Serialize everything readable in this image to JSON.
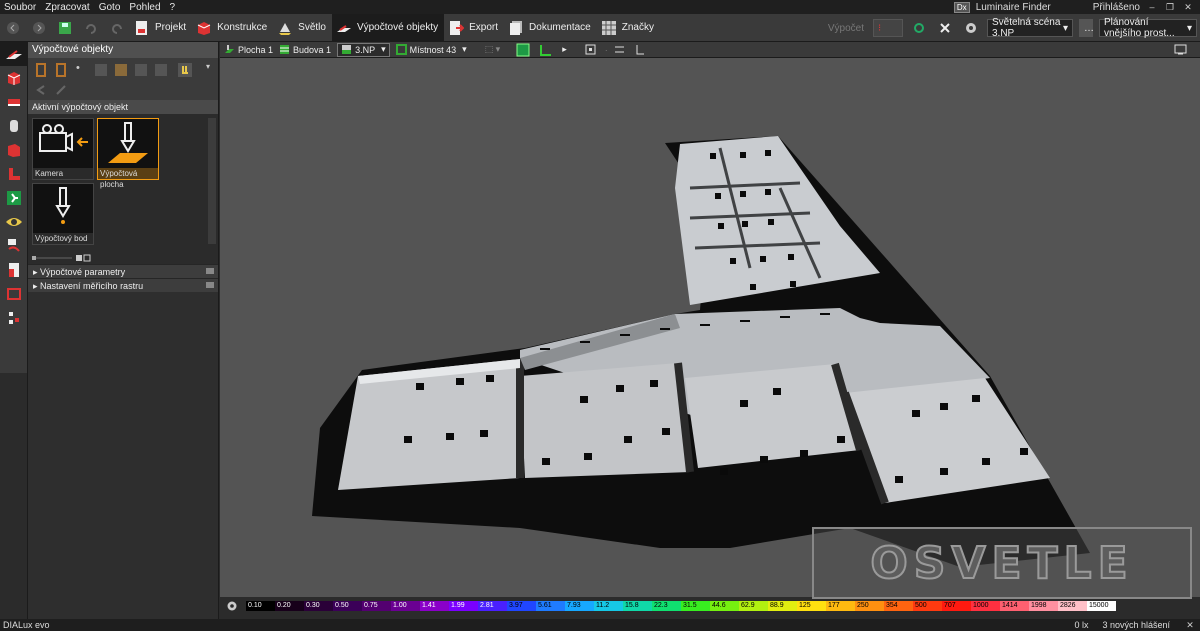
{
  "menu": [
    "Soubor",
    "Zpracovat",
    "Goto",
    "Pohled",
    "?"
  ],
  "topright": {
    "badge": "Dx",
    "finder": "Luminaire Finder",
    "login": "Přihlášeno"
  },
  "toolbar": {
    "modes": [
      "Projekt",
      "Konstrukce",
      "Světlo",
      "Výpočtové objekty",
      "Export",
      "Dokumentace",
      "Značky"
    ],
    "active_mode": "Výpočtové objekty",
    "calc_label": "Výpočet",
    "scene": "Světelná scéna 3.NP",
    "planning": "Plánování vnějšího prost..."
  },
  "panel": {
    "title": "Výpočtové objekty",
    "section": "Aktivní výpočtový objekt",
    "cards": [
      "Kamera",
      "Výpočtová plocha",
      "Výpočtový bod"
    ],
    "collapsibles": [
      "Výpočtové parametry",
      "Nastavení měřicího rastru"
    ]
  },
  "breadcrumb": [
    "Plocha 1",
    "Budova 1",
    "3.NP",
    "Místnost 43"
  ],
  "scale": [
    "0.10",
    "0.20",
    "0.30",
    "0.50",
    "0.75",
    "1.00",
    "1.41",
    "1.99",
    "2.81",
    "3.97",
    "5.61",
    "7.93",
    "11.2",
    "15.8",
    "22.3",
    "31.5",
    "44.6",
    "62.9",
    "88.9",
    "125",
    "177",
    "250",
    "354",
    "500",
    "707",
    "1000",
    "1414",
    "1998",
    "2826",
    "15000"
  ],
  "scale_colors": [
    "#000000",
    "#17001a",
    "#2a0038",
    "#3b0058",
    "#530070",
    "#6a0092",
    "#8a00c8",
    "#7a00ff",
    "#4a20ff",
    "#2046ff",
    "#1f7bff",
    "#17a8ff",
    "#16c8e6",
    "#10d8a8",
    "#10e070",
    "#38ee20",
    "#76f010",
    "#b2f010",
    "#e2ee10",
    "#ffe010",
    "#ffba10",
    "#ff9010",
    "#ff6410",
    "#ff3a10",
    "#ff1a10",
    "#ff3040",
    "#ff6070",
    "#ff90a0",
    "#ffc0c8",
    "#ffffff"
  ],
  "status": {
    "app": "DIALux evo",
    "lux": "0 lx",
    "messages": "3 nových hlášení"
  },
  "watermark": "OSVETLE"
}
